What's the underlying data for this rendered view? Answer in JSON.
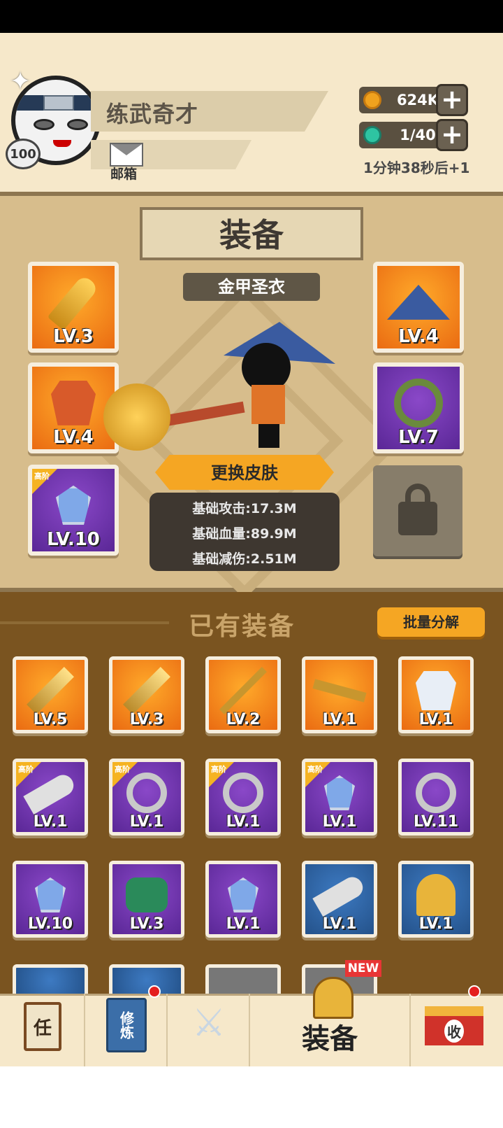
{
  "player": {
    "name": "练武奇才",
    "level": "100",
    "mail_label": "邮箱"
  },
  "resources": {
    "coins": "624K",
    "energy": "1/40",
    "energy_timer": "1分钟38秒后+1",
    "plus": "+"
  },
  "equip": {
    "title": "装备",
    "skin_name": "金甲圣衣",
    "change_skin": "更换皮肤",
    "stats": [
      "基础攻击:17.3M",
      "基础血量:89.9M",
      "基础减伤:2.51M"
    ],
    "slots": [
      {
        "lv": "LV.3",
        "quality": "orange",
        "icon": "mace-icon"
      },
      {
        "lv": "LV.4",
        "quality": "orange",
        "icon": "armor-icon"
      },
      {
        "lv": "LV.10",
        "quality": "purple",
        "icon": "amulet-icon",
        "advanced": "高阶"
      },
      {
        "lv": "LV.4",
        "quality": "orange",
        "icon": "straw-hat-icon"
      },
      {
        "lv": "LV.7",
        "quality": "purple",
        "icon": "ring-icon"
      }
    ]
  },
  "inventory": {
    "title": "已有装备",
    "batch_button": "批量分解",
    "new_badge": "NEW",
    "items": [
      {
        "lv": "LV.5",
        "quality": "orange",
        "icon": "sword-icon"
      },
      {
        "lv": "LV.3",
        "quality": "orange",
        "icon": "sword-icon"
      },
      {
        "lv": "LV.2",
        "quality": "orange",
        "icon": "spear-icon"
      },
      {
        "lv": "LV.1",
        "quality": "orange",
        "icon": "key-icon"
      },
      {
        "lv": "LV.1",
        "quality": "orange",
        "icon": "armor-icon"
      },
      {
        "lv": "LV.1",
        "quality": "purple",
        "icon": "blade-icon",
        "advanced": "高阶"
      },
      {
        "lv": "LV.1",
        "quality": "purple",
        "icon": "ring-icon",
        "advanced": "高阶"
      },
      {
        "lv": "LV.1",
        "quality": "purple",
        "icon": "ring-icon",
        "advanced": "高阶"
      },
      {
        "lv": "LV.1",
        "quality": "purple",
        "icon": "amulet-icon",
        "advanced": "高阶"
      },
      {
        "lv": "LV.11",
        "quality": "purple",
        "icon": "ring-icon"
      },
      {
        "lv": "LV.10",
        "quality": "purple",
        "icon": "amulet-icon"
      },
      {
        "lv": "LV.3",
        "quality": "purple",
        "icon": "bracer-icon"
      },
      {
        "lv": "LV.1",
        "quality": "purple",
        "icon": "amulet-icon"
      },
      {
        "lv": "LV.1",
        "quality": "blue",
        "icon": "blade-icon"
      },
      {
        "lv": "LV.1",
        "quality": "blue",
        "icon": "helmet-icon"
      }
    ]
  },
  "tabs": {
    "task": "任",
    "cultivate": "修炼",
    "equip": "装备",
    "collect": "收"
  },
  "colors": {
    "orange": "#f5a623",
    "purple": "#6a35a8",
    "blue": "#2f6aaa",
    "panel": "#d7bd8c",
    "inventory_bg": "#7a5420"
  }
}
